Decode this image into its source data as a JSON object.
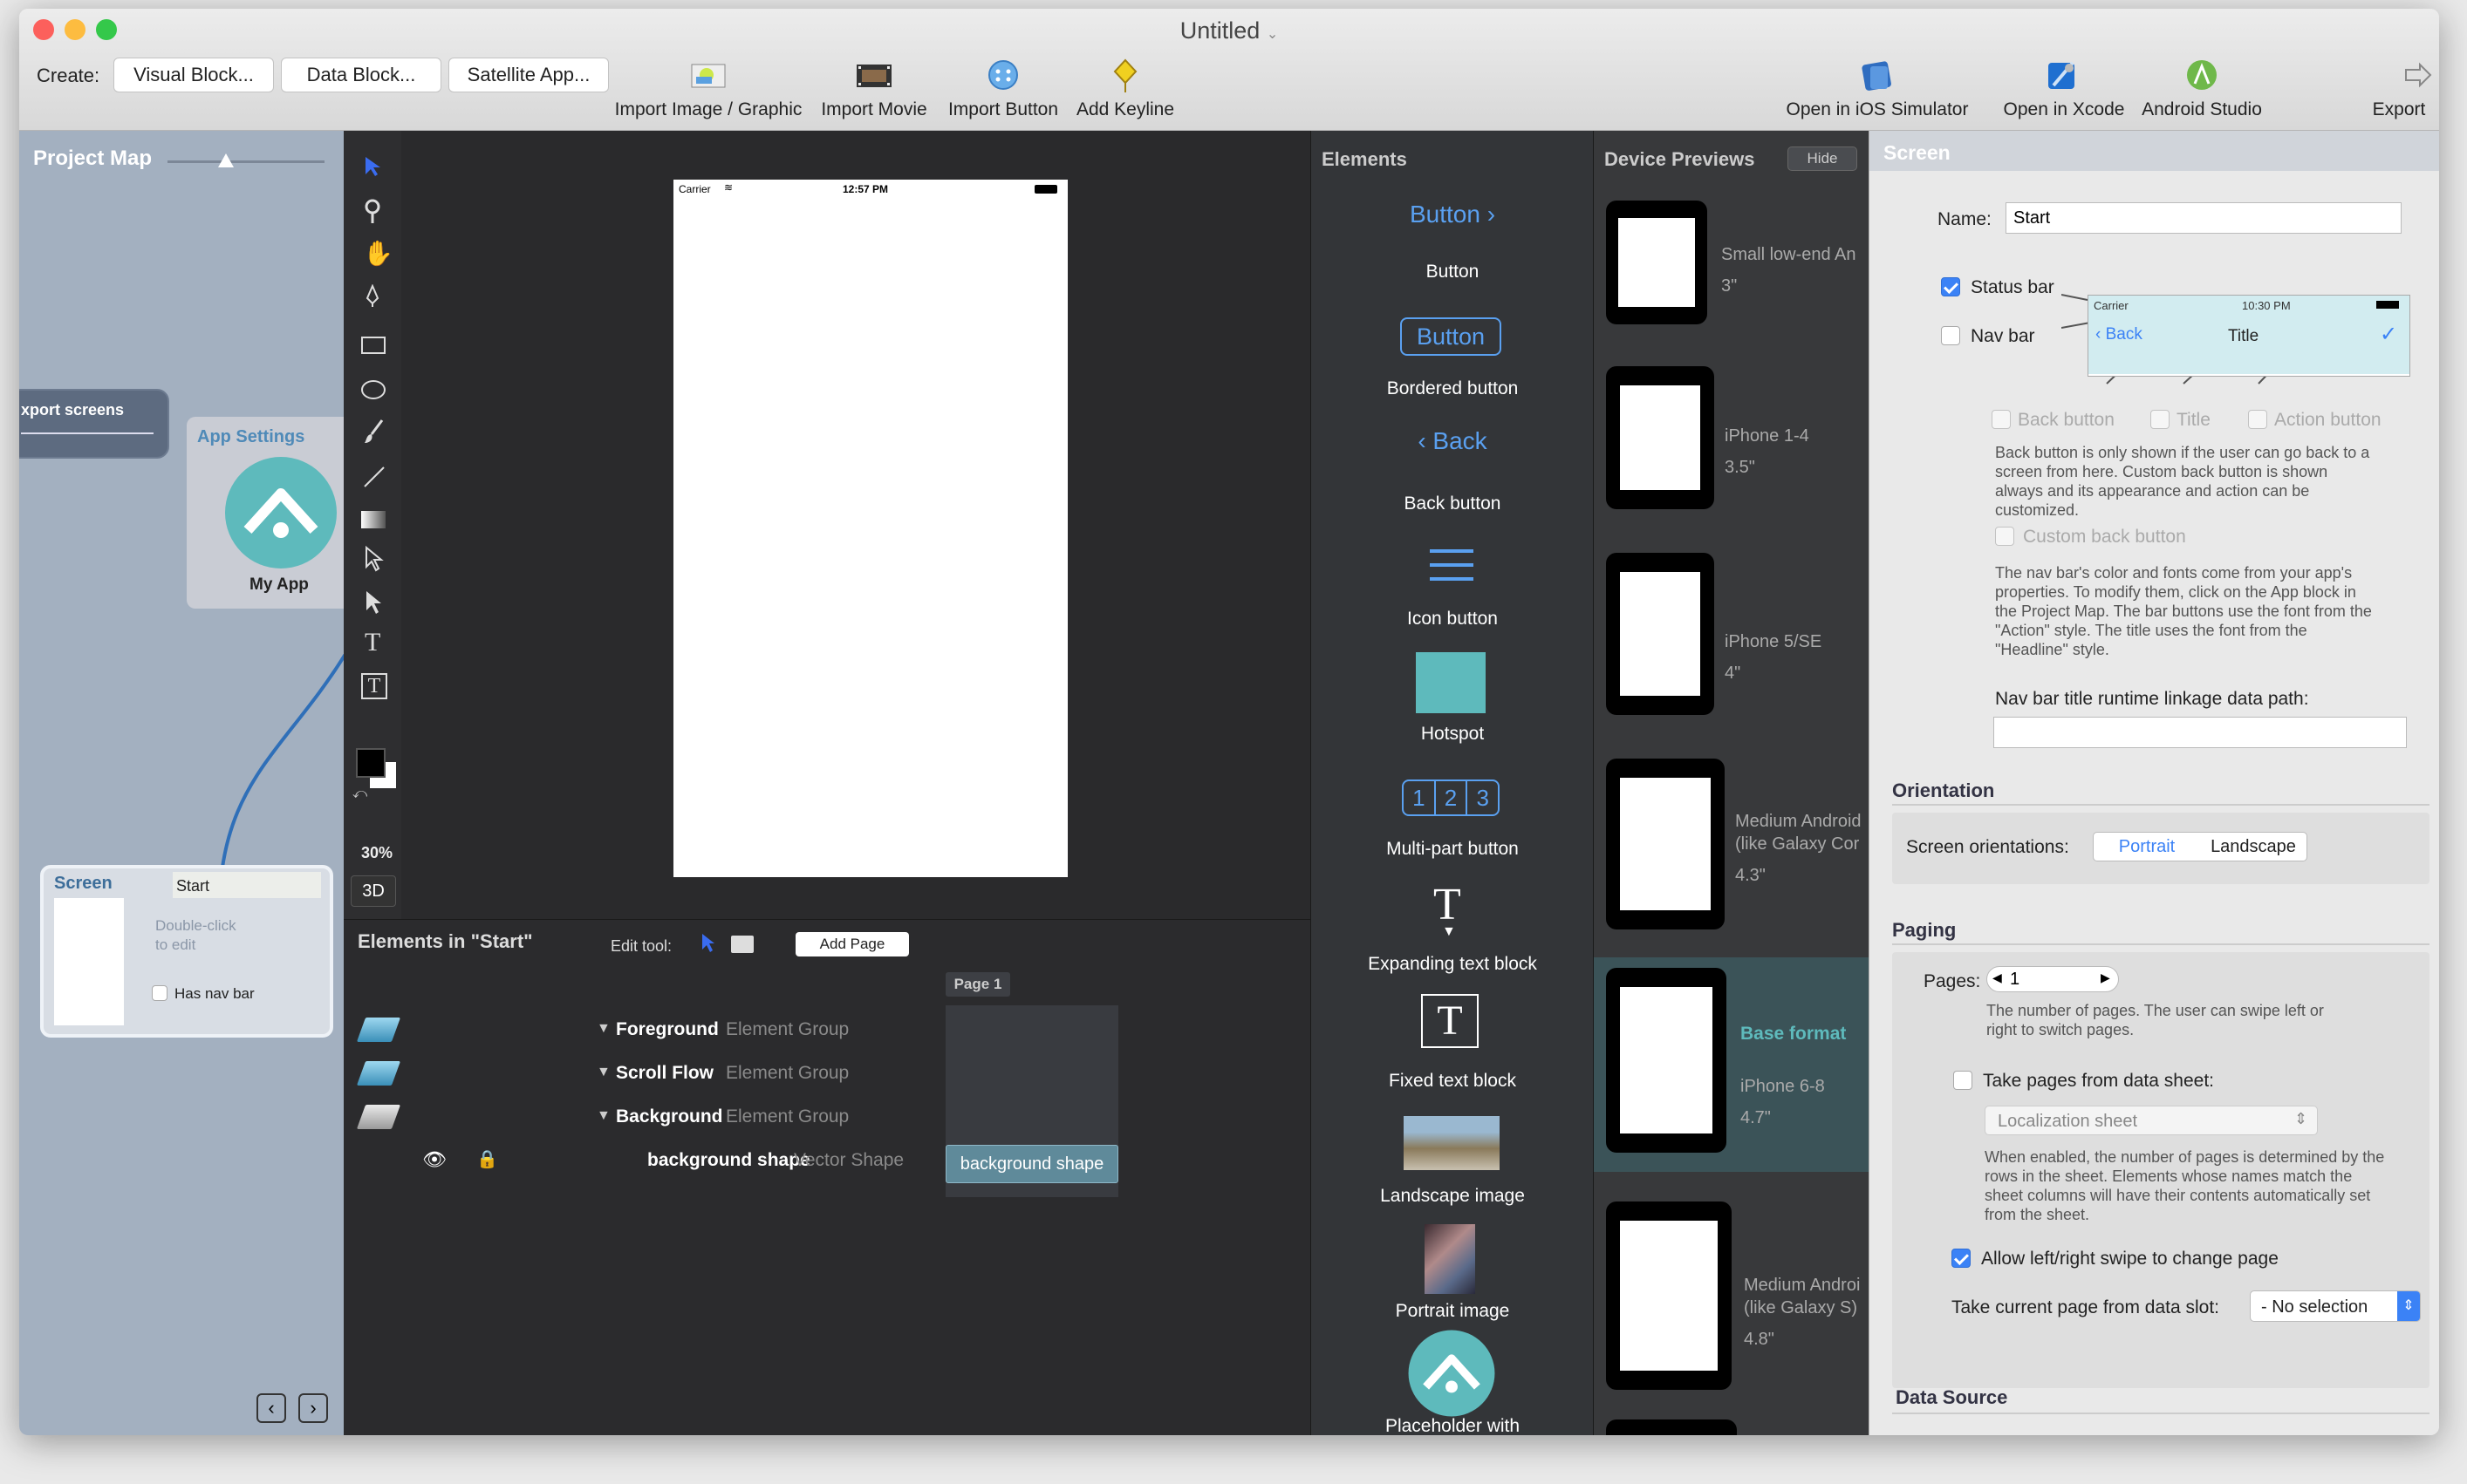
{
  "window": {
    "title": "Untitled"
  },
  "toolbar": {
    "create_label": "Create:",
    "visual_block": "Visual Block...",
    "data_block": "Data Block...",
    "satellite_app": "Satellite App...",
    "import_image": "Import Image / Graphic",
    "import_movie": "Import Movie",
    "import_button": "Import Button",
    "add_keyline": "Add Keyline",
    "open_ios_sim": "Open in iOS Simulator",
    "open_xcode": "Open in Xcode",
    "android_studio": "Android Studio",
    "export": "Export"
  },
  "project_map": {
    "title": "Project Map",
    "export_screens": "xport screens",
    "app_settings": "App Settings",
    "my_app": "My App",
    "screen_label": "Screen",
    "screen_name": "Start",
    "double_click": "Double-click",
    "to_edit": "to edit",
    "has_nav_bar": "Has nav bar"
  },
  "canvas": {
    "zoom": "30%",
    "view3d": "3D",
    "carrier": "Carrier",
    "time": "12:57 PM"
  },
  "element_list": {
    "title": "Elements in \"Start\"",
    "edit_tool": "Edit tool:",
    "add_page": "Add Page",
    "page1": "Page 1",
    "rows": [
      {
        "name": "Foreground",
        "type": "Element Group"
      },
      {
        "name": "Scroll Flow",
        "type": "Element Group"
      },
      {
        "name": "Background",
        "type": "Element Group"
      },
      {
        "name": "background shape",
        "type": "Vector Shape"
      }
    ],
    "selected_chip": "background shape"
  },
  "elements": {
    "title": "Elements",
    "button_preview": "Button",
    "bordered_preview": "Button",
    "back_preview": "Back",
    "items": [
      "Button",
      "Bordered button",
      "Back button",
      "Icon button",
      "Hotspot",
      "Multi-part button",
      "Expanding text block",
      "Fixed text block",
      "Landscape image",
      "Portrait image",
      "Placeholder with"
    ],
    "multi_1": "1",
    "multi_2": "2",
    "multi_3": "3"
  },
  "devices": {
    "title": "Device Previews",
    "hide": "Hide",
    "list": [
      {
        "name": "Small low-end An",
        "size": "3\""
      },
      {
        "name": "iPhone 1-4",
        "size": "3.5\""
      },
      {
        "name": "iPhone 5/SE",
        "size": "4\""
      },
      {
        "name": "Medium Android",
        "name2": "(like Galaxy Cor",
        "size": "4.3\""
      },
      {
        "name": "Base format",
        "name2": "iPhone 6-8",
        "size": "4.7\""
      },
      {
        "name": "Medium Androi",
        "name2": "(like Galaxy S)",
        "size": "4.8\""
      }
    ]
  },
  "inspector": {
    "title": "Screen",
    "name_label": "Name:",
    "name_value": "Start",
    "status_bar": "Status bar",
    "nav_bar": "Nav bar",
    "prev_carrier": "Carrier",
    "prev_time": "10:30 PM",
    "prev_back": "Back",
    "prev_title": "Title",
    "back_button": "Back button",
    "title_cb": "Title",
    "action_button": "Action button",
    "back_desc": "Back button is only shown if the user can go back to a screen from here. Custom back button is shown always and its appearance and action can be customized.",
    "custom_back": "Custom back button",
    "nav_desc": "The nav bar's color and fonts come from your app's properties. To modify them, click on the App block in the Project Map. The bar buttons use the font from the \"Action\" style. The title uses the font from the \"Headline\" style.",
    "nav_path_label": "Nav bar title runtime linkage data path:",
    "orientation_title": "Orientation",
    "screen_orient": "Screen orientations:",
    "portrait": "Portrait",
    "landscape": "Landscape",
    "paging_title": "Paging",
    "pages_label": "Pages:",
    "pages_value": "1",
    "pages_desc": "The number of pages. The user can swipe left or right to switch pages.",
    "take_pages": "Take pages from data sheet:",
    "loc_sheet": "Localization sheet",
    "sheet_desc": "When enabled, the number of pages is determined by the rows in the sheet. Elements whose names match the sheet columns will have their contents automatically set from the sheet.",
    "allow_swipe": "Allow left/right swipe to change page",
    "take_current": "Take current page from data slot:",
    "no_selection": "- No selection",
    "data_source": "Data Source"
  }
}
